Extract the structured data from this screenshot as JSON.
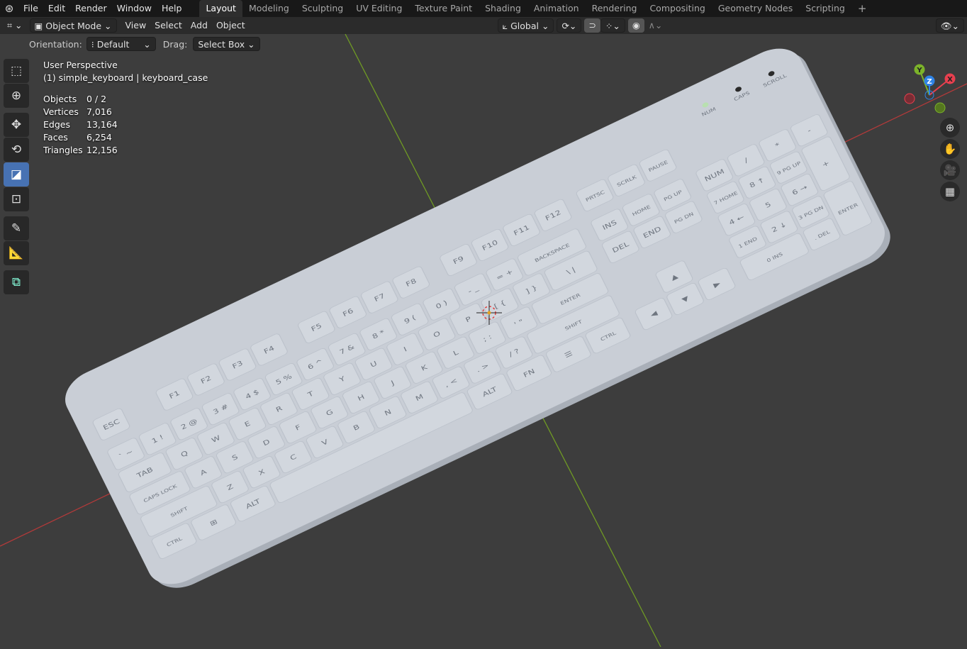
{
  "topbar": {
    "menus": [
      "File",
      "Edit",
      "Render",
      "Window",
      "Help"
    ],
    "workspaces": [
      "Layout",
      "Modeling",
      "Sculpting",
      "UV Editing",
      "Texture Paint",
      "Shading",
      "Animation",
      "Rendering",
      "Compositing",
      "Geometry Nodes",
      "Scripting"
    ],
    "active_workspace": "Layout",
    "add_icon": "plus-icon"
  },
  "header": {
    "mode": "Object Mode",
    "menus": [
      "View",
      "Select",
      "Add",
      "Object"
    ],
    "orientation_global": "Global"
  },
  "tool_settings": {
    "orientation_label": "Orientation:",
    "orientation_value": "Default",
    "drag_label": "Drag:",
    "drag_value": "Select Box"
  },
  "toolbar": {
    "tools": [
      "select-box",
      "cursor",
      "move",
      "rotate",
      "scale",
      "transform",
      "annotate",
      "measure",
      "add-cube"
    ],
    "active": "scale",
    "active_color": "#4772b3"
  },
  "overlay": {
    "view": "User Perspective",
    "object": "(1) simple_keyboard | keyboard_case",
    "stats": [
      {
        "label": "Objects",
        "value": "0 / 2"
      },
      {
        "label": "Vertices",
        "value": "7,016"
      },
      {
        "label": "Edges",
        "value": "13,164"
      },
      {
        "label": "Faces",
        "value": "6,254"
      },
      {
        "label": "Triangles",
        "value": "12,156"
      }
    ]
  },
  "gizmo": {
    "x": "X",
    "y": "Y",
    "z": "Z",
    "x_color": "#e8404f",
    "y_color": "#7cb32a",
    "z_color": "#2f83e6"
  },
  "colors": {
    "x_axis": "#b33a3a",
    "y_axis": "#6f9a24",
    "viewport": "#3d3d3d",
    "keyboard": "#c9ced6"
  },
  "keyboard": {
    "indicators": [
      "NUM",
      "CAPS",
      "SCROLL"
    ],
    "main": [
      [
        "ESC",
        "F1",
        "F2",
        "F3",
        "F4",
        "F5",
        "F6",
        "F7",
        "F8",
        "F9",
        "F10",
        "F11",
        "F12"
      ],
      [
        "` ~",
        "1 !",
        "2 @",
        "3 #",
        "4 $",
        "5 %",
        "6 ^",
        "7 &",
        "8 *",
        "9 (",
        "0 )",
        "- _",
        "= +",
        "BACKSPACE"
      ],
      [
        "TAB",
        "Q",
        "W",
        "E",
        "R",
        "T",
        "Y",
        "U",
        "I",
        "O",
        "P",
        "[ {",
        "] }",
        "\\ |"
      ],
      [
        "CAPS LOCK",
        "A",
        "S",
        "D",
        "F",
        "G",
        "H",
        "J",
        "K",
        "L",
        "; :",
        "' \"",
        "ENTER"
      ],
      [
        "SHIFT",
        "Z",
        "X",
        "C",
        "V",
        "B",
        "N",
        "M",
        ", <",
        ". >",
        "/ ?",
        "SHIFT"
      ],
      [
        "CTRL",
        "⊞",
        "ALT",
        "",
        "ALT",
        "FN",
        "☰",
        "CTRL"
      ]
    ],
    "nav": [
      [
        "PRTSC",
        "SCRLK",
        "PAUSE"
      ],
      [
        "INS",
        "HOME",
        "PG UP"
      ],
      [
        "DEL",
        "END",
        "PG DN"
      ],
      [
        "▲"
      ],
      [
        "◀",
        "▼",
        "▶"
      ]
    ],
    "numpad": [
      [
        "NUM",
        "/",
        "*",
        "-"
      ],
      [
        "7 HOME",
        "8 ↑",
        "9 PG UP",
        "+"
      ],
      [
        "4 ←",
        "5",
        "6 →"
      ],
      [
        "1 END",
        "2 ↓",
        "3 PG DN",
        "ENTER"
      ],
      [
        "0 INS",
        ". DEL"
      ]
    ]
  }
}
